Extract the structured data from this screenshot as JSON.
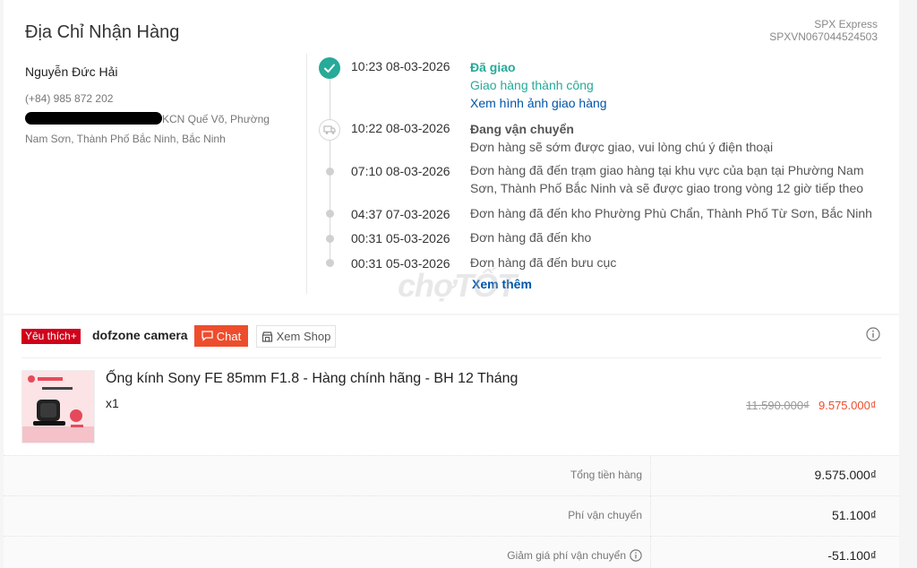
{
  "address": {
    "title": "Địa Chỉ Nhận Hàng",
    "carrier_name": "SPX Express",
    "tracking_number": "SPXVN067044524503",
    "recipient_name": "Nguyễn Đức Hải",
    "phone": "(+84) 985 872 202",
    "address_line": "KCN Quế Võ, Phường Nam Sơn, Thành Phố Bắc Ninh, Bắc Ninh"
  },
  "timeline": {
    "events": [
      {
        "time": "10:23 08-03-2026",
        "status": "Đã giao",
        "desc": "Giao hàng thành công",
        "link": "Xem hình ảnh giao hàng"
      },
      {
        "time": "10:22 08-03-2026",
        "status": "Đang vận chuyển",
        "desc": "Đơn hàng sẽ sớm được giao, vui lòng chú ý điện thoại"
      },
      {
        "time": "07:10 08-03-2026",
        "desc": "Đơn hàng đã đến trạm giao hàng tại khu vực của bạn tại Phường Nam Sơn, Thành Phố Bắc Ninh và sẽ được giao trong vòng 12 giờ tiếp theo"
      },
      {
        "time": "04:37 07-03-2026",
        "desc": "Đơn hàng đã đến kho Phường Phù Chẩn, Thành Phố Từ Sơn, Bắc Ninh"
      },
      {
        "time": "00:31 05-03-2026",
        "desc": "Đơn hàng đã đến kho"
      },
      {
        "time": "00:31 05-03-2026",
        "desc": "Đơn hàng đã đến bưu cục"
      }
    ],
    "see_more": "Xem thêm"
  },
  "shop": {
    "badge": "Yêu thích+",
    "name": "dofzone camera",
    "chat_label": "Chat",
    "view_shop_label": "Xem Shop"
  },
  "product": {
    "title": "Ống kính Sony FE 85mm F1.8 - Hàng chính hãng - BH 12 Tháng",
    "qty": "x1",
    "price_original": "11.590.000₫",
    "price_current": "9.575.000₫"
  },
  "summary": [
    {
      "label": "Tổng tiền hàng",
      "value": "9.575.000₫"
    },
    {
      "label": "Phí vận chuyển",
      "value": "51.100₫"
    },
    {
      "label": "Giảm giá phí vận chuyển",
      "value": "-51.100₫"
    }
  ],
  "watermark": "chợTỐT",
  "colors": {
    "accent": "#ee4d2d",
    "success": "#26aa99",
    "link": "#0055aa",
    "badge": "#d0011b"
  }
}
